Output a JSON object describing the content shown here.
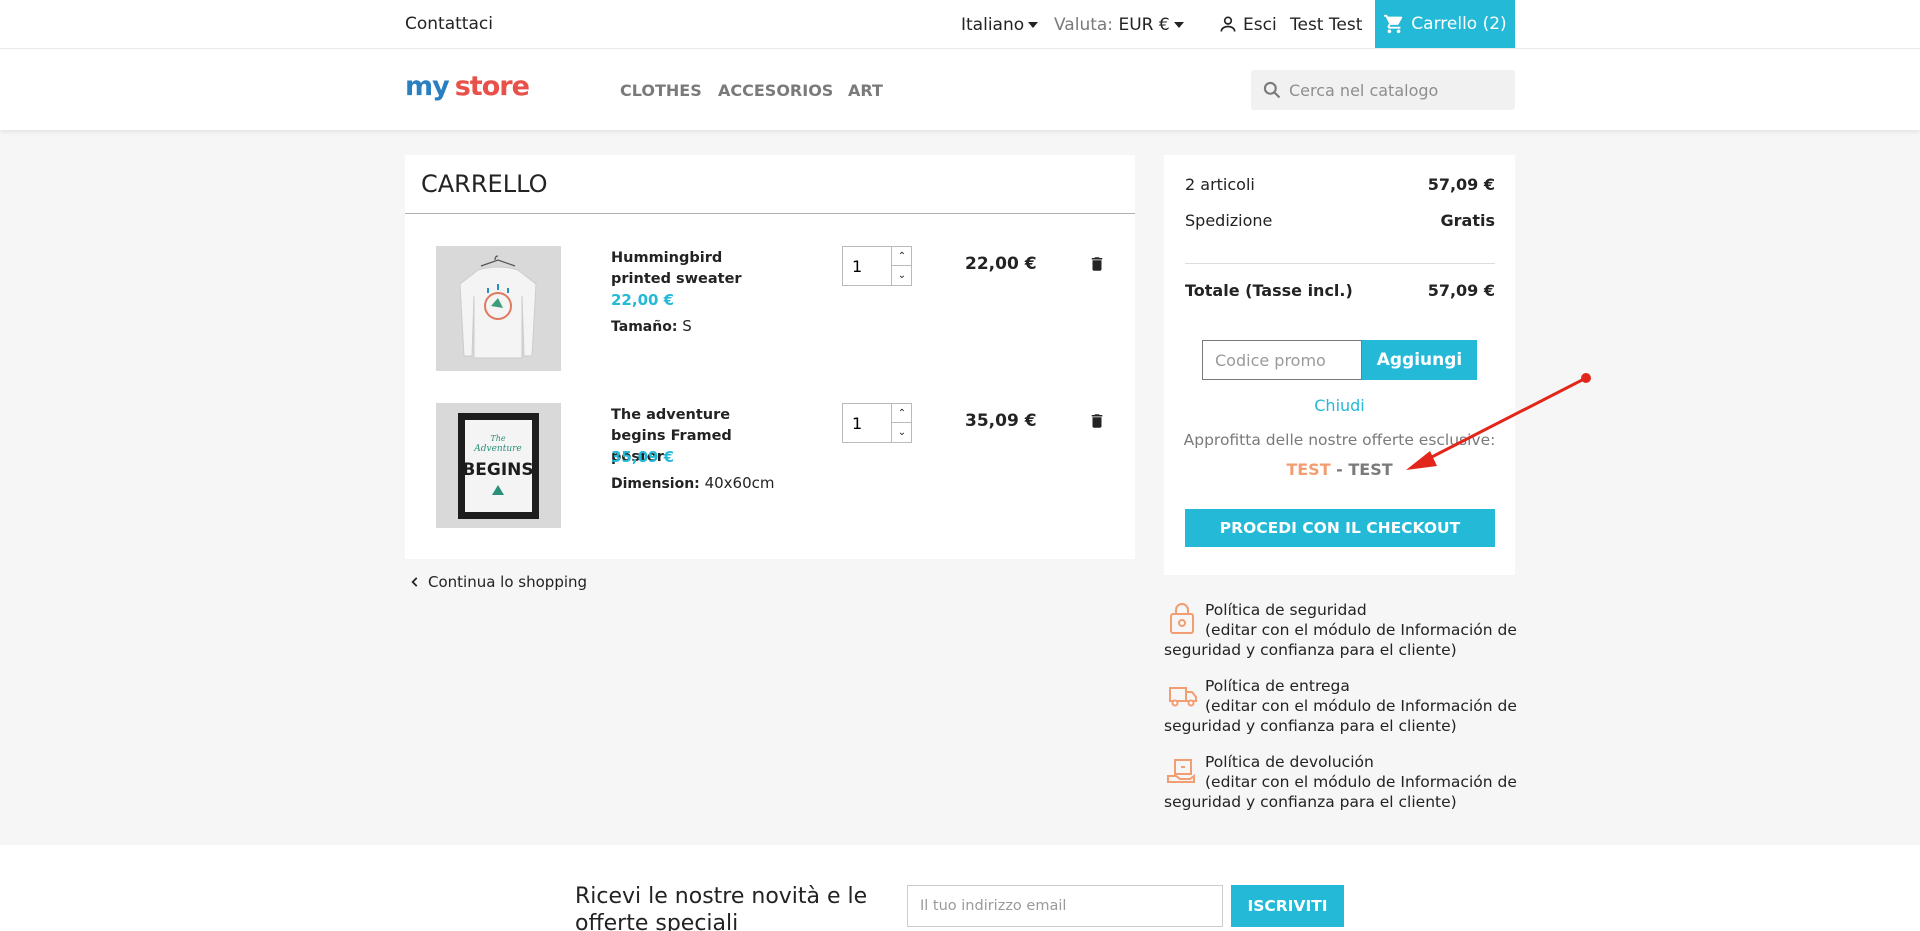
{
  "topbar": {
    "contact": "Contattaci",
    "language": "Italiano",
    "currency_label": "Valuta:",
    "currency_value": "EUR €",
    "signout": "Esci",
    "username": "Test Test",
    "cart": "Carrello (2)"
  },
  "header": {
    "logo": {
      "part1": "my",
      "part2": "store"
    },
    "nav": [
      "CLOTHES",
      "ACCESORIOS",
      "ART"
    ],
    "search_placeholder": "Cerca nel catalogo"
  },
  "cart": {
    "title": "CARRELLO",
    "items": [
      {
        "name": "Hummingbird printed sweater",
        "unit_price": "22,00 €",
        "attr_label": "Tamaño:",
        "attr_value": "S",
        "qty": "1",
        "total": "22,00 €"
      },
      {
        "name": "The adventure begins Framed poster",
        "unit_price": "35,09 €",
        "attr_label": "Dimension:",
        "attr_value": "40x60cm",
        "qty": "1",
        "total": "35,09 €",
        "poster_text": {
          "line1": "The",
          "line2": "Adventure",
          "line3": "BEGINS"
        }
      }
    ],
    "continue": "Continua lo shopping"
  },
  "summary": {
    "items_label": "2 articoli",
    "items_value": "57,09 €",
    "shipping_label": "Spedizione",
    "shipping_value": "Gratis",
    "total_label": "Totale (Tasse incl.)",
    "total_value": "57,09 €",
    "promo_placeholder": "Codice promo",
    "promo_button": "Aggiungi",
    "close": "Chiudi",
    "offers_text": "Approfitta delle nostre offerte esclusive:",
    "offer_code": "TEST",
    "offer_sep": " - ",
    "offer_name": "TEST",
    "checkout": "PROCEDI CON IL CHECKOUT"
  },
  "reassurance": [
    {
      "title": "Política de seguridad",
      "desc": "(editar con el módulo de Información de seguridad y confianza para el cliente)",
      "icon": "lock-icon"
    },
    {
      "title": "Política de entrega",
      "desc": "(editar con el módulo de Información de seguridad y confianza para el cliente)",
      "icon": "truck-icon"
    },
    {
      "title": "Política de devolución",
      "desc": "(editar con el módulo de Información de seguridad y confianza para el cliente)",
      "icon": "return-box-icon"
    }
  ],
  "newsletter": {
    "title": "Ricevi le nostre novità e le offerte speciali",
    "placeholder": "Il tuo indirizzo email",
    "button": "ISCRIVITI"
  },
  "colors": {
    "accent": "#24b9d7",
    "offer": "#f39d72",
    "annotation": "#e2261c"
  }
}
